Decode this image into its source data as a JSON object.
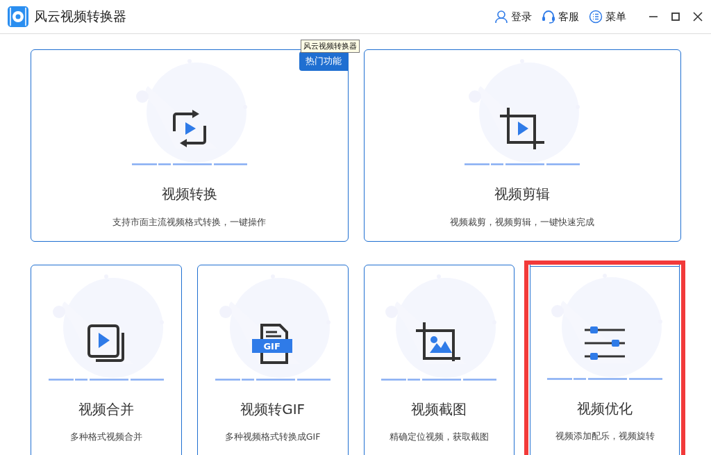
{
  "window": {
    "title": "风云视频转换器"
  },
  "header_actions": [
    {
      "kind": "user",
      "label": "登录"
    },
    {
      "kind": "headset",
      "label": "客服"
    },
    {
      "kind": "list",
      "label": "菜单"
    }
  ],
  "tooltip": "风云视频转换器",
  "top_cards": [
    {
      "kind": "convert",
      "title": "视频转换",
      "description": "支持市面主流视频格式转换，一键操作",
      "badge": "热门功能",
      "selected": false
    },
    {
      "kind": "crop",
      "title": "视频剪辑",
      "description": "视频裁剪，视频剪辑，一键快速完成",
      "selected": false
    }
  ],
  "bottom_cards": [
    {
      "kind": "merge",
      "title": "视频合并",
      "description": "多种格式视频合并",
      "selected": false
    },
    {
      "kind": "gif",
      "icon_text": "GIF",
      "title": "视频转GIF",
      "description": "多种视频格式转换成GIF",
      "selected": false
    },
    {
      "kind": "screenshot",
      "title": "视频截图",
      "description": "精确定位视频，获取截图",
      "selected": false
    },
    {
      "kind": "sliders",
      "title": "视频优化",
      "description": "视频添加配乐，视频旋转",
      "selected": true
    }
  ]
}
